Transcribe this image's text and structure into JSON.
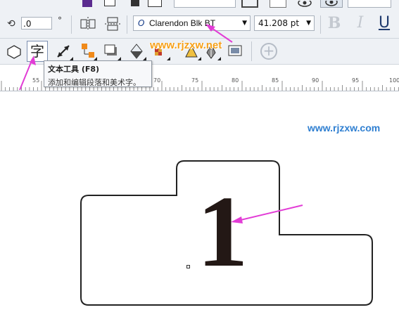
{
  "property_bar": {
    "angle_value": ".0",
    "angle_unit": "°",
    "font_name": "Clarendon Blk BT",
    "font_size": "41.208 pt",
    "bold_label": "B",
    "italic_label": "I",
    "underline_label": "U"
  },
  "toolbox": {
    "text_tool_glyph": "字",
    "add_label": "+"
  },
  "tooltip": {
    "title": "文本工具 (F8)",
    "description": "添加和编辑段落和美术字。"
  },
  "ruler": {
    "labels": [
      "55",
      "70",
      "75",
      "80",
      "85",
      "90",
      "95",
      "100"
    ]
  },
  "watermarks": {
    "main": "www.rjzxw.net",
    "side": "www.rjzxw.com"
  },
  "canvas": {
    "text": "1"
  },
  "colors": {
    "arrow": "#e23cd6",
    "watermark_main": "#f6a019",
    "watermark_side": "#2f7fd1",
    "shape_stroke": "#222222",
    "digit": "#231815"
  }
}
